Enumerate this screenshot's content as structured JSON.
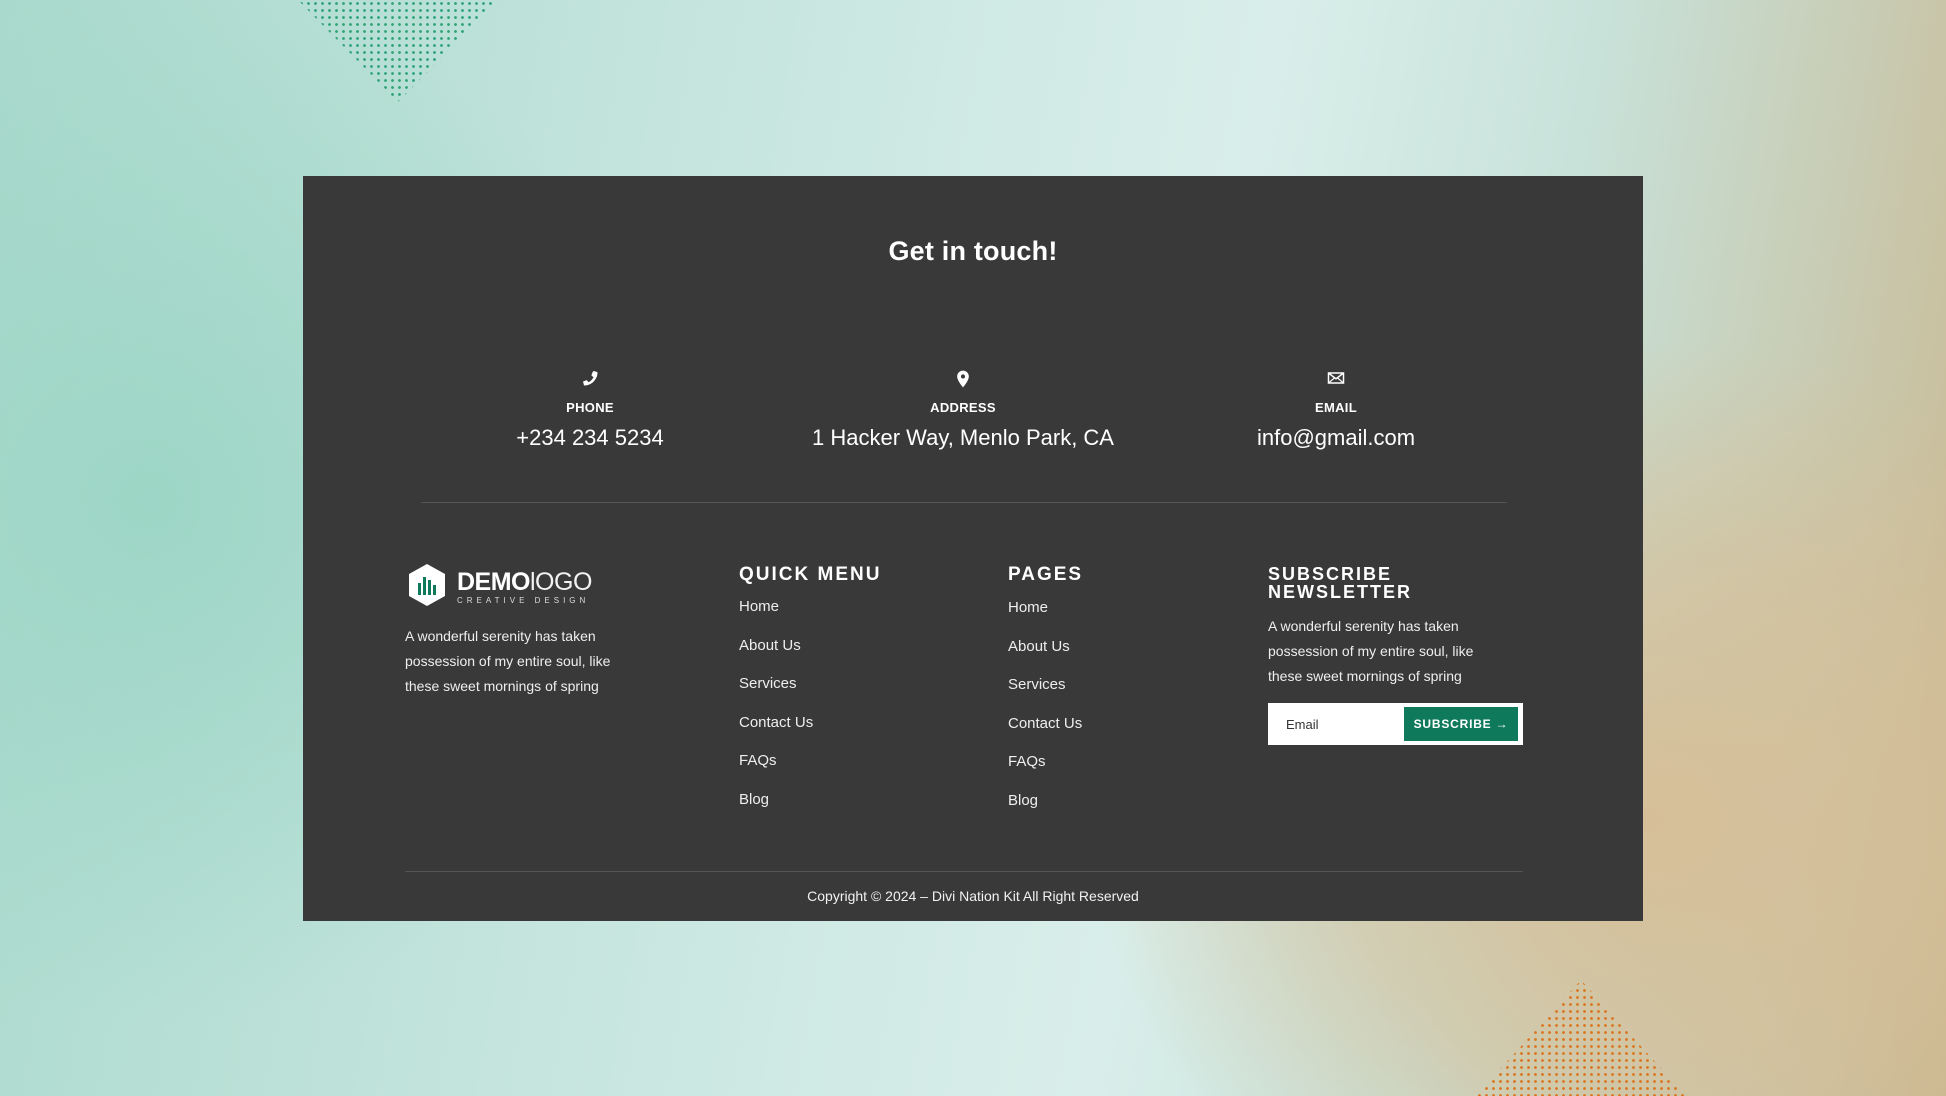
{
  "page": {
    "heading": "Get in touch!"
  },
  "contacts": [
    {
      "icon": "phone-icon",
      "label": "PHONE",
      "value": "+234 234 5234"
    },
    {
      "icon": "location-pin-icon",
      "label": "ADDRESS",
      "value": "1 Hacker Way, Menlo Park, CA"
    },
    {
      "icon": "envelope-icon",
      "label": "EMAIL",
      "value": "info@gmail.com"
    }
  ],
  "logo": {
    "name_bold": "DEMO",
    "name_light": "lOGO",
    "tagline": "CREATIVE DESIGN",
    "icon": "bar-chart-hexagon-logo-icon"
  },
  "about": {
    "text": "A wonderful serenity has taken possession of my entire soul, like these sweet mornings of spring"
  },
  "quick_menu": {
    "title": "QUICK MENU",
    "items": [
      "Home",
      "About Us",
      "Services",
      "Contact Us",
      "FAQs",
      "Blog"
    ]
  },
  "pages_menu": {
    "title": "PAGES",
    "items": [
      "Home",
      "About Us",
      "Services",
      "Contact Us",
      "FAQs",
      "Blog"
    ]
  },
  "newsletter": {
    "title_line1": "SUBSCRIBE",
    "title_line2": "NEWSLETTER",
    "text": "A wonderful serenity has taken possession of my entire soul, like these sweet mornings of spring",
    "placeholder": "Email",
    "button_label": "SUBSCRIBE →"
  },
  "copyright": "Copyright © 2024 – Divi Nation Kit All Right Reserved",
  "colors": {
    "footer_bg": "#393939",
    "accent_green": "#0f7a5b",
    "dots_green": "#2fa377",
    "dots_orange": "#d9761f"
  }
}
